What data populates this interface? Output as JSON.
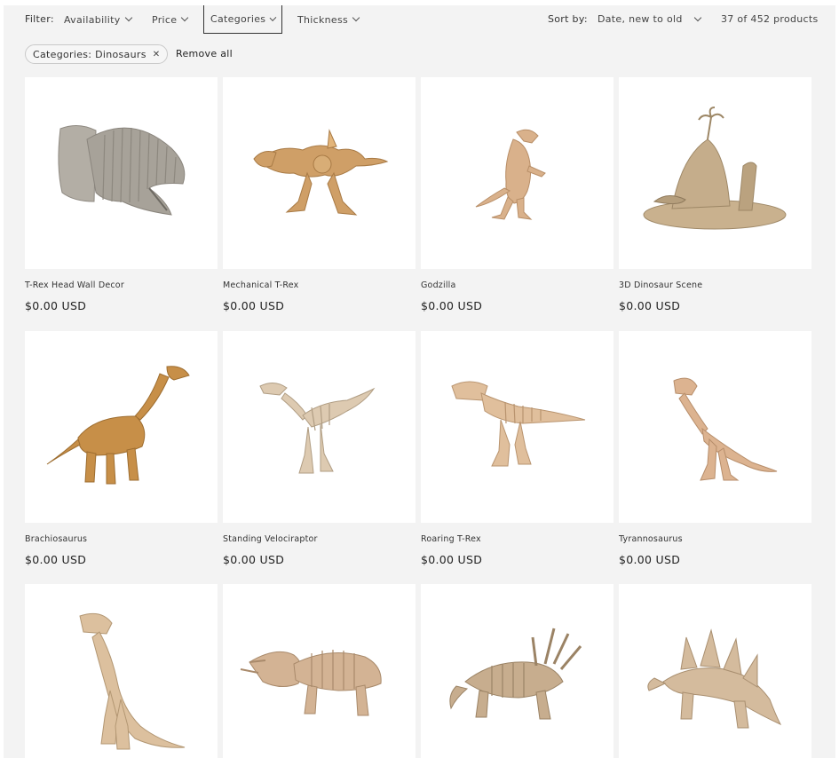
{
  "filter": {
    "label": "Filter:",
    "items": [
      {
        "label": "Availability"
      },
      {
        "label": "Price"
      },
      {
        "label": "Categories",
        "active": true
      },
      {
        "label": "Thickness"
      }
    ]
  },
  "sort": {
    "label": "Sort by:",
    "value": "Date, new to old"
  },
  "product_count": "37 of 452 products",
  "active_filters": {
    "facet": "Categories: Dinosaurs",
    "remove_icon": "close-icon",
    "remove_all": "Remove all"
  },
  "products": [
    {
      "title": "T-Rex Head Wall Decor",
      "price": "$0.00 USD",
      "image": "trex-head-wall-mount",
      "tone": "#a9a49b"
    },
    {
      "title": "Mechanical T-Rex",
      "price": "$0.00 USD",
      "image": "mechanical-trex",
      "tone": "#c89a64"
    },
    {
      "title": "Godzilla",
      "price": "$0.00 USD",
      "image": "godzilla",
      "tone": "#d4ab85"
    },
    {
      "title": "3D Dinosaur Scene",
      "price": "$0.00 USD",
      "image": "dinosaur-scene",
      "tone": "#bfa886"
    },
    {
      "title": "Brachiosaurus",
      "price": "$0.00 USD",
      "image": "brachiosaurus",
      "tone": "#c08a45"
    },
    {
      "title": "Standing Velociraptor",
      "price": "$0.00 USD",
      "image": "velociraptor-skeleton",
      "tone": "#d9c6ad"
    },
    {
      "title": "Roaring T-Rex",
      "price": "$0.00 USD",
      "image": "trex-skeleton",
      "tone": "#ddb996"
    },
    {
      "title": "Tyrannosaurus",
      "price": "$0.00 USD",
      "image": "tyrannosaurus-skeleton",
      "tone": "#d8ad8a"
    },
    {
      "title": "",
      "price": "",
      "image": "upright-trex-skeleton",
      "tone": "#d9bd9b"
    },
    {
      "title": "",
      "price": "",
      "image": "triceratops-skeleton",
      "tone": "#cfb091"
    },
    {
      "title": "",
      "price": "",
      "image": "styracosaurus-skeleton",
      "tone": "#bfa585"
    },
    {
      "title": "",
      "price": "",
      "image": "stegosaurus-skeleton",
      "tone": "#cfb597"
    }
  ]
}
